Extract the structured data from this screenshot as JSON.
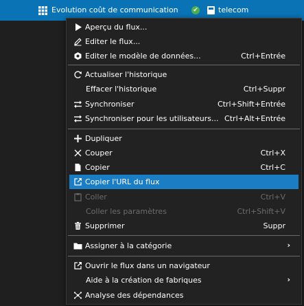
{
  "titlebar": {
    "title": "Evolution coût de communication",
    "status": "telecom"
  },
  "menu": {
    "items": [
      {
        "label": "Aperçu du flux...",
        "shortcut": "",
        "icon": "play-icon",
        "enabled": true
      },
      {
        "label": "Editer le flux...",
        "shortcut": "",
        "icon": "pencil-icon",
        "enabled": true
      },
      {
        "label": "Editer le modèle de données...",
        "shortcut": "Ctrl+Entrée",
        "icon": "data-model-icon",
        "enabled": true
      },
      {
        "label": "Actualiser l'historique",
        "shortcut": "",
        "icon": "refresh-icon",
        "enabled": true
      },
      {
        "label": "Effacer l'historique",
        "shortcut": "Ctrl+Suppr",
        "icon": "",
        "enabled": true
      },
      {
        "label": "Synchroniser",
        "shortcut": "Ctrl+Shift+Entrée",
        "icon": "sync-icon",
        "enabled": true
      },
      {
        "label": "Synchroniser pour les utilisateurs...",
        "shortcut": "Ctrl+Alt+Entrée",
        "icon": "sync-icon",
        "enabled": true
      },
      {
        "label": "Dupliquer",
        "shortcut": "",
        "icon": "plus-icon",
        "enabled": true
      },
      {
        "label": "Couper",
        "shortcut": "Ctrl+X",
        "icon": "cut-icon",
        "enabled": true
      },
      {
        "label": "Copier",
        "shortcut": "Ctrl+C",
        "icon": "copy-icon",
        "enabled": true
      },
      {
        "label": "Copier l'URL du flux",
        "shortcut": "",
        "icon": "external-link-icon",
        "enabled": true,
        "highlighted": true
      },
      {
        "label": "Coller",
        "shortcut": "Ctrl+V",
        "icon": "paste-icon",
        "enabled": false
      },
      {
        "label": "Coller les paramètres",
        "shortcut": "Ctrl+Shift+V",
        "icon": "",
        "enabled": false
      },
      {
        "label": "Supprimer",
        "shortcut": "Suppr",
        "icon": "trash-icon",
        "enabled": true
      },
      {
        "label": "Assigner à la catégorie",
        "shortcut": "",
        "icon": "folder-icon",
        "enabled": true,
        "submenu": true
      },
      {
        "label": "Ouvrir le flux dans un navigateur",
        "shortcut": "",
        "icon": "external-link-icon",
        "enabled": true
      },
      {
        "label": "Aide à la création de fabriques",
        "shortcut": "",
        "icon": "",
        "enabled": true,
        "submenu": true
      },
      {
        "label": "Analyse des dépendances",
        "shortcut": "",
        "icon": "dependency-icon",
        "enabled": true
      }
    ],
    "submenu_arrow": "›"
  },
  "colors": {
    "titlebar_bg": "#0a73b5",
    "highlight_bg": "#1b7ec4",
    "menu_bg": "#222222",
    "disabled_text": "#6c6c6c"
  }
}
